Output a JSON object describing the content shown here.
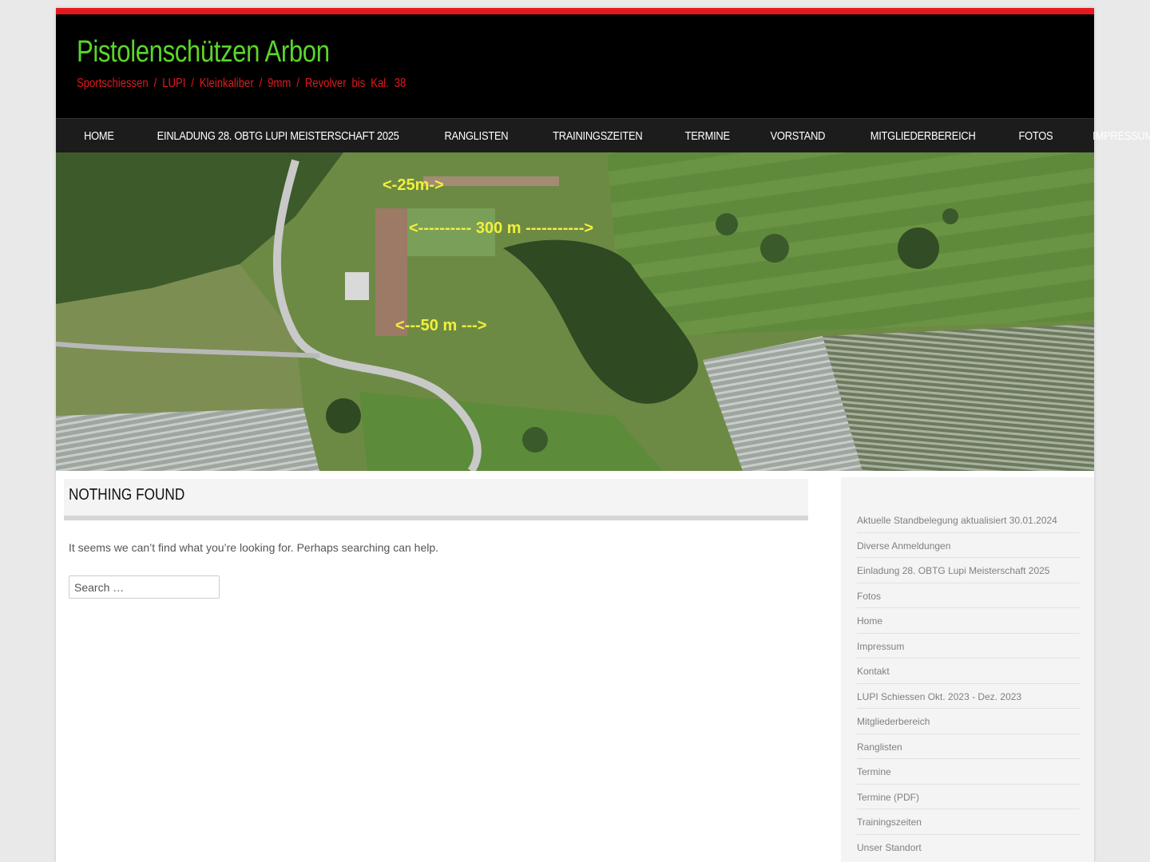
{
  "site": {
    "title": "Pistolenschützen Arbon",
    "description": "Sportschiessen / LUPI / Kleinkaliber / 9mm / Revolver bis Kal. 38"
  },
  "nav": {
    "items": [
      {
        "label": "Home"
      },
      {
        "label": "Einladung 28. OBTG Lupi Meisterschaft 2025"
      },
      {
        "label": "Ranglisten"
      },
      {
        "label": "Trainingszeiten"
      },
      {
        "label": "Termine"
      },
      {
        "label": "Vorstand"
      },
      {
        "label": "Mitgliederbereich"
      },
      {
        "label": "Fotos"
      },
      {
        "label": "Impressum"
      }
    ]
  },
  "banner": {
    "labels": [
      "<-25m->",
      "<---------- 300 m ----------->",
      "<---50 m --->"
    ]
  },
  "main": {
    "title": "Nothing Found",
    "message": "It seems we can’t find what you’re looking for. Perhaps searching can help.",
    "search_placeholder": "Search …"
  },
  "sidebar": {
    "items": [
      {
        "label": "Aktuelle Standbelegung aktualisiert 30.01.2024"
      },
      {
        "label": "Diverse Anmeldungen"
      },
      {
        "label": "Einladung 28. OBTG Lupi Meisterschaft 2025"
      },
      {
        "label": "Fotos"
      },
      {
        "label": "Home"
      },
      {
        "label": "Impressum"
      },
      {
        "label": "Kontakt"
      },
      {
        "label": "LUPI Schiessen Okt. 2023 - Dez. 2023"
      },
      {
        "label": "Mitgliederbereich"
      },
      {
        "label": "Ranglisten"
      },
      {
        "label": "Termine"
      },
      {
        "label": "Termine (PDF)"
      },
      {
        "label": "Trainingszeiten"
      },
      {
        "label": "Unser Standort"
      }
    ]
  },
  "colors": {
    "accent_red": "#e4191f",
    "title_green": "#5bd52a",
    "header_bg": "#000000",
    "nav_bg": "#1c1c1c"
  }
}
